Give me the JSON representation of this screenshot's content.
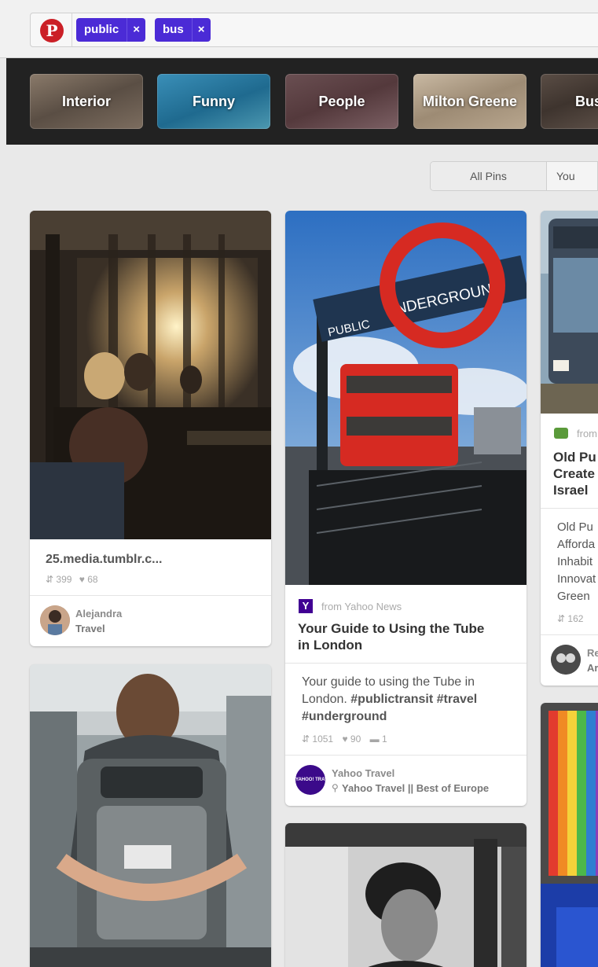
{
  "search": {
    "logo_glyph": "P",
    "tokens": [
      {
        "label": "public",
        "remove": "×"
      },
      {
        "label": "bus",
        "remove": "×"
      }
    ]
  },
  "categories": [
    "Interior",
    "Funny",
    "People",
    "Milton Greene",
    "Bus"
  ],
  "pin_filter": {
    "all": "All Pins",
    "yours": "You"
  },
  "pins": {
    "bus_interior": {
      "title": "25.media.tumblr.c...",
      "repins": "399",
      "likes": "68",
      "user": "Alejandra",
      "board": "Travel"
    },
    "tube": {
      "source": "from Yahoo News",
      "source_logo": "Y",
      "title_line1": "Your Guide to Using the Tube",
      "title_line2": "in London",
      "desc_line1": "Your guide to using the Tube in",
      "desc_line2_text": "London. ",
      "desc_line2_tags": "#publictransit #travel",
      "desc_line3": "#underground",
      "repins": "1051",
      "likes": "90",
      "comments": "1",
      "user": "Yahoo Travel",
      "board": "Yahoo Travel || Best of Europe",
      "avatar_text": "YAHOO! TRAVEL",
      "sign_top": "PUBLIC",
      "sign_main": "UNDERGROUND"
    },
    "israel": {
      "source": "from",
      "title_lines": [
        "Old Pu",
        "Create",
        "Israel"
      ],
      "desc_lines": [
        "Old Pu",
        "Afforda",
        "Inhabit",
        "Innovat",
        "Green"
      ],
      "repins": "162",
      "user": "Re",
      "board": "Ar"
    }
  },
  "colors": {
    "pinterest_red": "#cb2027",
    "token_purple": "#4b2bd6",
    "category_bar": "#222222"
  }
}
